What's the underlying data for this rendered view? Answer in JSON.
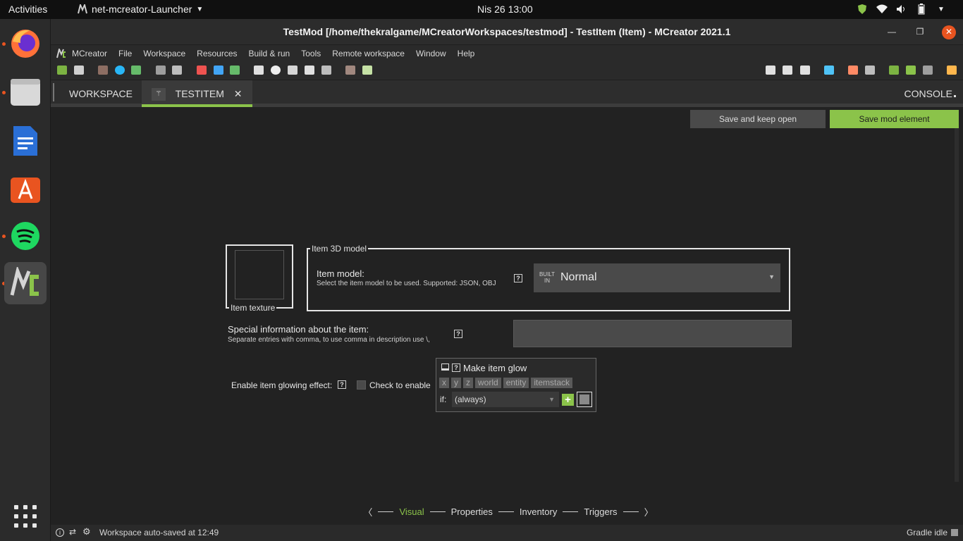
{
  "topbar": {
    "activities": "Activities",
    "app_name": "net-mcreator-Launcher",
    "clock": "Nis 26  13:00"
  },
  "window": {
    "title": "TestMod [/home/thekralgame/MCreatorWorkspaces/testmod] - TestItem (Item) - MCreator 2021.1"
  },
  "menu": [
    "MCreator",
    "File",
    "Workspace",
    "Resources",
    "Build & run",
    "Tools",
    "Remote workspace",
    "Window",
    "Help"
  ],
  "tabs": {
    "workspace": "WORKSPACE",
    "active": "TESTITEM",
    "close": "✕",
    "console": "CONSOLE"
  },
  "actions": {
    "save_keep_open": "Save and keep open",
    "save_element": "Save mod element"
  },
  "form": {
    "texture_label": "Item texture",
    "model_group": "Item 3D model",
    "model_label": "Item model:",
    "model_hint": "Select the item model to be used. Supported: JSON, OBJ",
    "model_badge": "BUILT IN",
    "model_value": "Normal",
    "special_label": "Special information about the item:",
    "special_hint": "Separate entries with comma, to use comma in description use \\,",
    "special_value": "",
    "glow_label": "Enable item glowing effect:",
    "glow_checkbox": "Check to enable",
    "glow_checked": false,
    "procedure": {
      "title": "Make item glow",
      "deps": [
        "x",
        "y",
        "z",
        "world",
        "entity",
        "itemstack"
      ],
      "if_label": "if:",
      "condition": "(always)"
    },
    "help": "?"
  },
  "pages": {
    "items": [
      "Visual",
      "Properties",
      "Inventory",
      "Triggers"
    ],
    "active": "Visual"
  },
  "status": {
    "message": "Workspace auto-saved at 12:49",
    "gradle": "Gradle idle"
  },
  "colors": {
    "accent": "#8bc34a",
    "ubuntu_orange": "#e95420",
    "background": "#222222"
  }
}
